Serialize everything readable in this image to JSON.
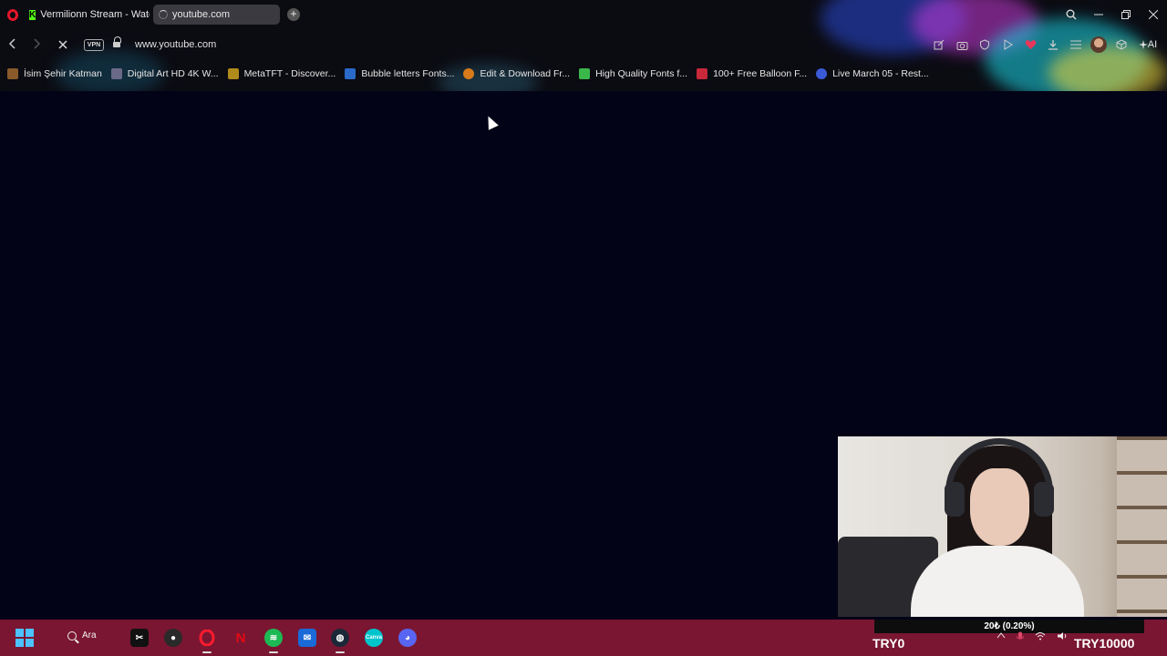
{
  "browser": {
    "tabs": [
      {
        "title": "Vermilionn Stream - Watc",
        "icon": "kick-icon"
      },
      {
        "title": "youtube.com",
        "icon": "loading-spinner-icon"
      }
    ],
    "new_tab_glyph": "+",
    "address": {
      "vpn_label": "VPN",
      "url": "www.youtube.com"
    },
    "ai_label": "AI",
    "bookmarks": [
      {
        "label": "İsim Şehir Katman",
        "icon_color": "#8a5a2a"
      },
      {
        "label": "Digital Art HD 4K W...",
        "icon_color": "#6a6a88"
      },
      {
        "label": "MetaTFT - Discover...",
        "icon_color": "#b08a1a"
      },
      {
        "label": "Bubble letters Fonts...",
        "icon_color": "#2a6ac8"
      },
      {
        "label": "Edit & Download Fr...",
        "icon_color": "#d87a1a"
      },
      {
        "label": "High Quality Fonts f...",
        "icon_color": "#3ab84a"
      },
      {
        "label": "100+ Free Balloon F...",
        "icon_color": "#c8283a"
      },
      {
        "label": "Live March 05 - Rest...",
        "icon_color": "#3a5ad8"
      }
    ]
  },
  "overlay": {
    "donation_text": "20₺ (0.20%)",
    "try_left": "TRY0",
    "try_right": "TRY10000"
  },
  "taskbar": {
    "search_label": "Ara"
  },
  "colors": {
    "taskbar": "#7a1632",
    "page_background": "#030317",
    "opera_red": "#e3162a"
  }
}
